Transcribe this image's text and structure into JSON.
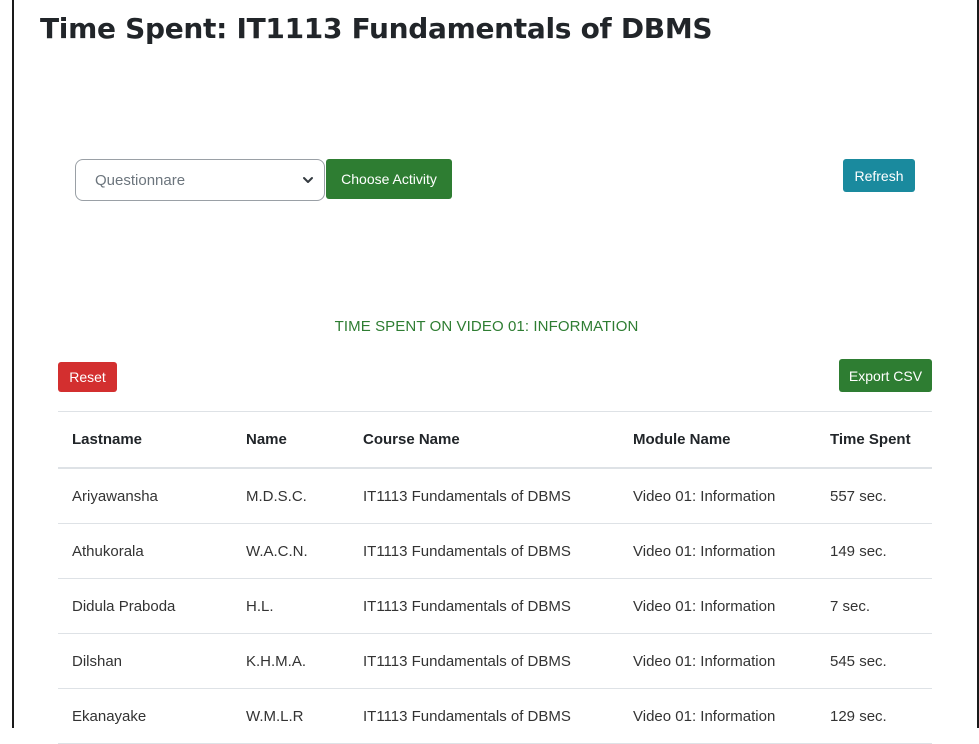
{
  "page": {
    "title": "Time Spent: IT1113 Fundamentals of DBMS"
  },
  "controls": {
    "activity_select_value": "Questionnare",
    "choose_label": "Choose Activity",
    "refresh_label": "Refresh",
    "reset_label": "Reset",
    "export_label": "Export CSV"
  },
  "report": {
    "heading": "TIME SPENT ON VIDEO 01: INFORMATION"
  },
  "table": {
    "headers": [
      "Lastname",
      "Name",
      "Course Name",
      "Module Name",
      "Time Spent"
    ],
    "rows": [
      [
        "Ariyawansha",
        "M.D.S.C.",
        "IT1113 Fundamentals of DBMS",
        "Video 01: Information",
        "557 sec."
      ],
      [
        "Athukorala",
        "W.A.C.N.",
        "IT1113 Fundamentals of DBMS",
        "Video 01: Information",
        "149 sec."
      ],
      [
        "Didula Praboda",
        "H.L.",
        "IT1113 Fundamentals of DBMS",
        "Video 01: Information",
        "7 sec."
      ],
      [
        "Dilshan",
        "K.H.M.A.",
        "IT1113 Fundamentals of DBMS",
        "Video 01: Information",
        "545 sec."
      ],
      [
        "Ekanayake",
        "W.M.L.R",
        "IT1113 Fundamentals of DBMS",
        "Video 01: Information",
        "129 sec."
      ]
    ]
  },
  "colors": {
    "primary_green": "#2e7d32",
    "refresh_teal": "#1a8a9e",
    "reset_red": "#d32f2f"
  },
  "icons": {
    "select_arrow": "chevron-down-icon"
  }
}
